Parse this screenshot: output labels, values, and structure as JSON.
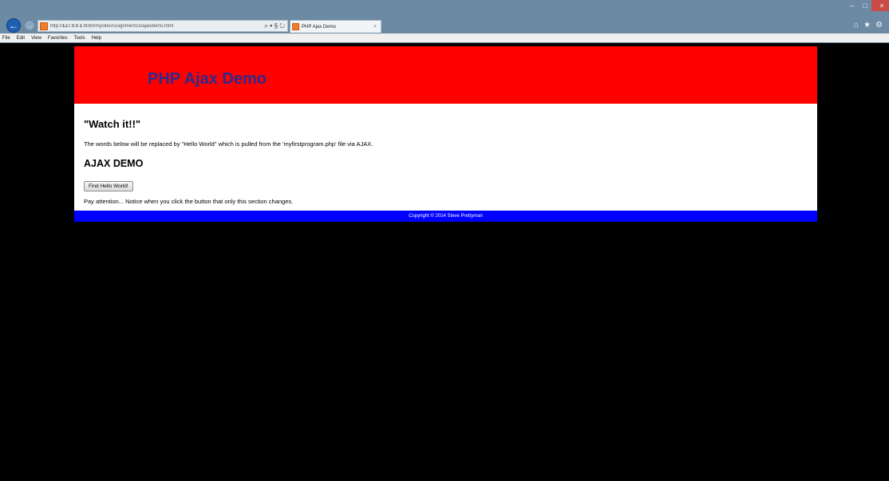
{
  "browser": {
    "url_prefix": "http://",
    "url_host": "127.0.0.1",
    "url_rest": ":8080/mysite/Assignment15/ajaxdemo.html",
    "address_tools": "⌕ ▾ § ↻",
    "tab_title": "PHP Ajax Demo",
    "tab_close": "×",
    "window_controls": {
      "minimize": "–",
      "maximize": "□",
      "close": "×"
    },
    "toolbar_icons": {
      "home": "⌂",
      "favorites": "★",
      "settings": "⚙"
    },
    "menu": [
      "File",
      "Edit",
      "View",
      "Favorites",
      "Tools",
      "Help"
    ]
  },
  "page": {
    "title": "PHP Ajax Demo",
    "heading_watch": "\"Watch it!!\"",
    "description": "The words below will be replaced by \"Hello World\" which is pulled from the 'myfirstprogram.php' file via AJAX.",
    "heading_ajax": "AJAX DEMO",
    "button_label": "Find Hello World!",
    "notice": "Pay attention... Notice when you click the button that only this section changes.",
    "footer": "Copyright © 2014 Steve Prettyman"
  },
  "colors": {
    "header_bg": "#ff0000",
    "title_color": "#2b2b8f",
    "footer_bg": "#0000ff",
    "page_bg": "#000000",
    "chrome_bg": "#6c8aa4"
  }
}
